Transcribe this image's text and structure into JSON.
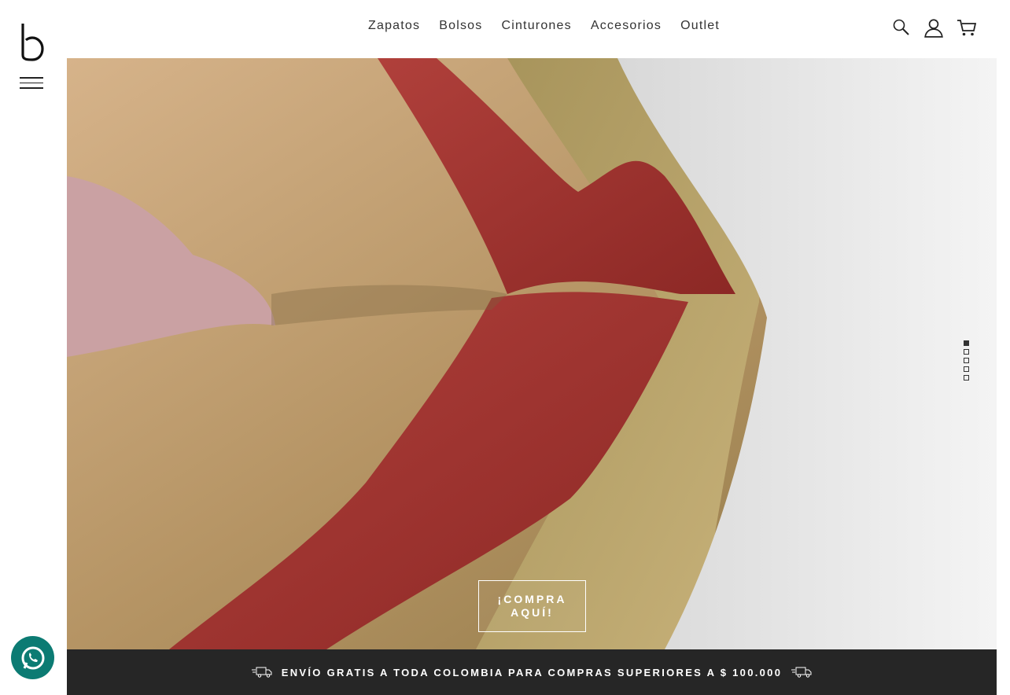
{
  "brand": {
    "logo_icon": "b-logo-icon"
  },
  "nav": {
    "items": [
      {
        "label": "Zapatos"
      },
      {
        "label": "Bolsos"
      },
      {
        "label": "Cinturones"
      },
      {
        "label": "Accesorios"
      },
      {
        "label": "Outlet"
      }
    ]
  },
  "header_icons": [
    "search-icon",
    "user-icon",
    "cart-icon"
  ],
  "hero": {
    "cta_line1": "¡COMPRA",
    "cta_line2": "AQUÍ!",
    "slides_total": 5,
    "active_slide": 1
  },
  "promo_bar": {
    "text": "ENVÍO GRATIS A TODA COLOMBIA PARA COMPRAS SUPERIORES A $ 100.000",
    "icon": "truck-icon"
  },
  "colors": {
    "bar_bg": "#262626",
    "whatsapp": "#0c7b73",
    "leather_red": "#a0332f",
    "leather_gold": "#b8a06a",
    "pink_bg": "#caa1a3"
  }
}
